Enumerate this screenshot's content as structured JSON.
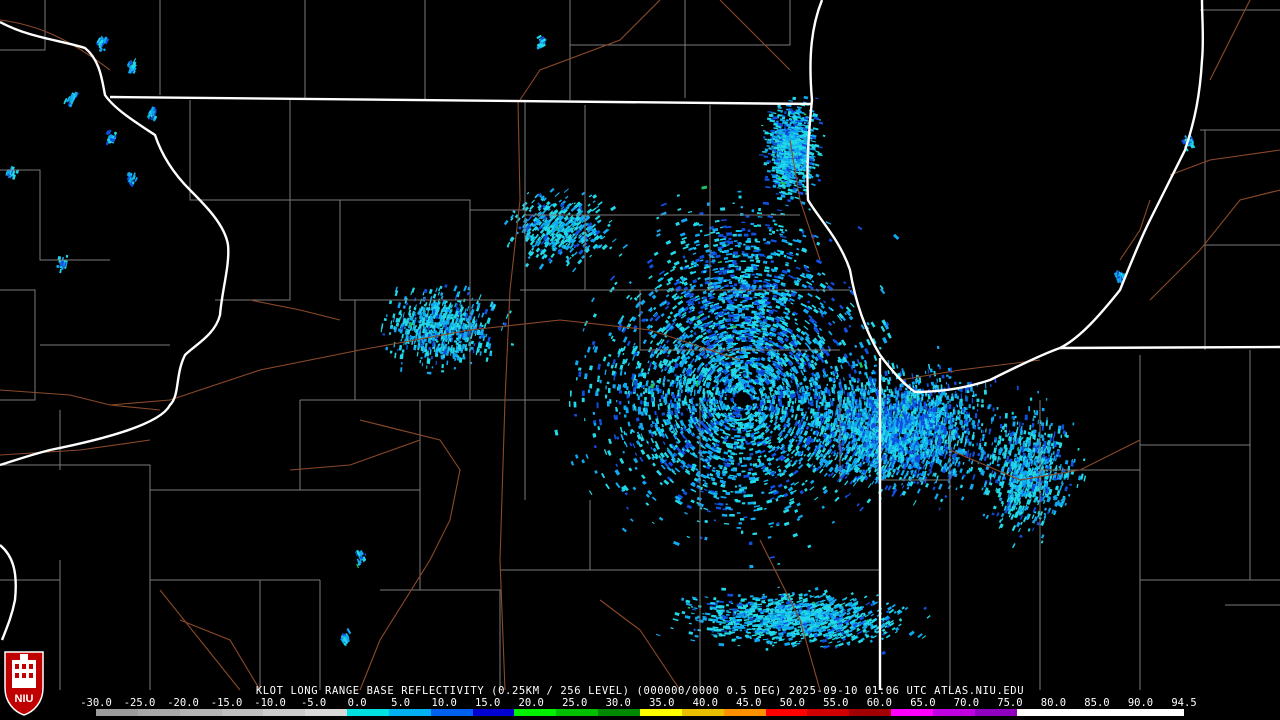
{
  "caption": "KLOT LONG RANGE BASE REFLECTIVITY (0.25KM / 256 LEVEL) (000000/0000 0.5 DEG) 2025-09-10 01:06 UTC  ATLAS.NIU.EDU",
  "scale_ticks": [
    "-30.0",
    "-25.0",
    "-20.0",
    "-15.0",
    "-10.0",
    "-5.0",
    "0.0",
    "5.0",
    "10.0",
    "15.0",
    "20.0",
    "25.0",
    "30.0",
    "35.0",
    "40.0",
    "45.0",
    "50.0",
    "55.0",
    "60.0",
    "65.0",
    "70.0",
    "75.0",
    "80.0",
    "85.0",
    "90.0",
    "94.5"
  ],
  "scale_colors": [
    "#9c9c9c",
    "#a8a8a8",
    "#b4b4b4",
    "#c0c0c0",
    "#cccccc",
    "#d8d8d8",
    "#00e0e0",
    "#00b0f0",
    "#0060f0",
    "#0000d0",
    "#00f000",
    "#00c000",
    "#008800",
    "#ffff00",
    "#e8c000",
    "#ff9000",
    "#ff0000",
    "#d00000",
    "#a00000",
    "#ff00ff",
    "#c000e0",
    "#9000c0",
    "#ffffff",
    "#ffffff",
    "#ffffff",
    "#ffffff"
  ],
  "logo_text": "NIU",
  "colors": {
    "state_border": "#ffffff",
    "county_border": "#808080",
    "highway": "#8b4a2a",
    "echo_light": "#20d8e8",
    "echo_mid": "#10a8f0",
    "echo_dark": "#1050e0",
    "echo_green": "#20c060"
  }
}
